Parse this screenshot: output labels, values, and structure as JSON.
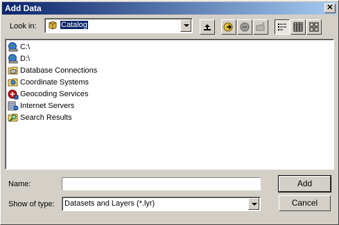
{
  "window": {
    "title": "Add Data",
    "close_label": "✕"
  },
  "lookin": {
    "label": "Look in:",
    "value": "Catalog"
  },
  "toolbar": {
    "icons": [
      "up-one-level-icon",
      "connect-folder-icon",
      "disconnect-icon",
      "new-folder-icon",
      "list-view-icon",
      "details-view-icon",
      "thumbnails-view-icon"
    ]
  },
  "items": [
    {
      "label": "C:\\",
      "icon": "drive-icon"
    },
    {
      "label": "D:\\",
      "icon": "drive-icon"
    },
    {
      "label": "Database Connections",
      "icon": "database-connections-icon"
    },
    {
      "label": "Coordinate Systems",
      "icon": "coordinate-systems-icon"
    },
    {
      "label": "Geocoding Services",
      "icon": "geocoding-services-icon"
    },
    {
      "label": "Internet Servers",
      "icon": "internet-servers-icon"
    },
    {
      "label": "Search Results",
      "icon": "search-results-icon"
    }
  ],
  "name_field": {
    "label": "Name:",
    "value": ""
  },
  "type_field": {
    "label": "Show of type:",
    "value": "Datasets and Layers (*.lyr)"
  },
  "buttons": {
    "add": "Add",
    "cancel": "Cancel"
  }
}
